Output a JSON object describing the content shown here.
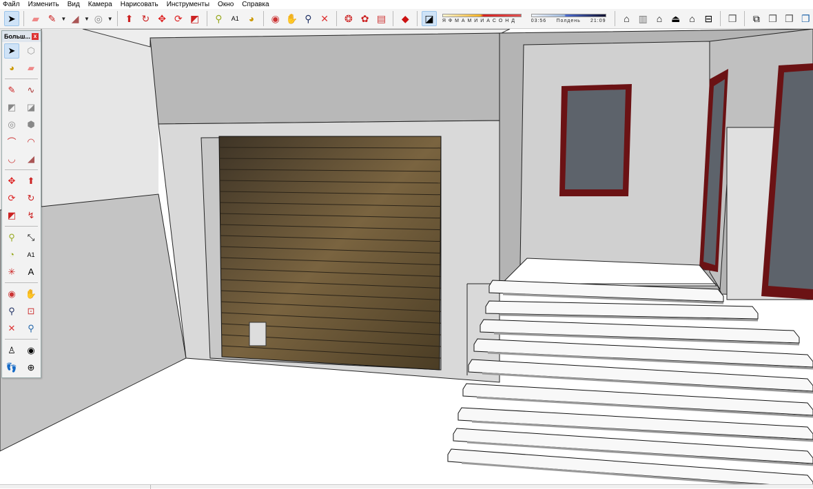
{
  "menu": [
    "Файл",
    "Изменить",
    "Вид",
    "Камера",
    "Нарисовать",
    "Инструменты",
    "Окно",
    "Справка"
  ],
  "shadow": {
    "months": "Я Ф М А М И И А С О Н Д",
    "time_start": "03:56",
    "time_mid": "Полдень",
    "time_end": "21:09",
    "date_fraction": 0.48,
    "time_fraction": 0.44
  },
  "palette": {
    "title": "Больш...",
    "close": "x"
  },
  "colors": {
    "accent": "#cfe3f7",
    "door": "#5a4a30",
    "frame": "#6b1214",
    "glass": "#5d636b"
  }
}
